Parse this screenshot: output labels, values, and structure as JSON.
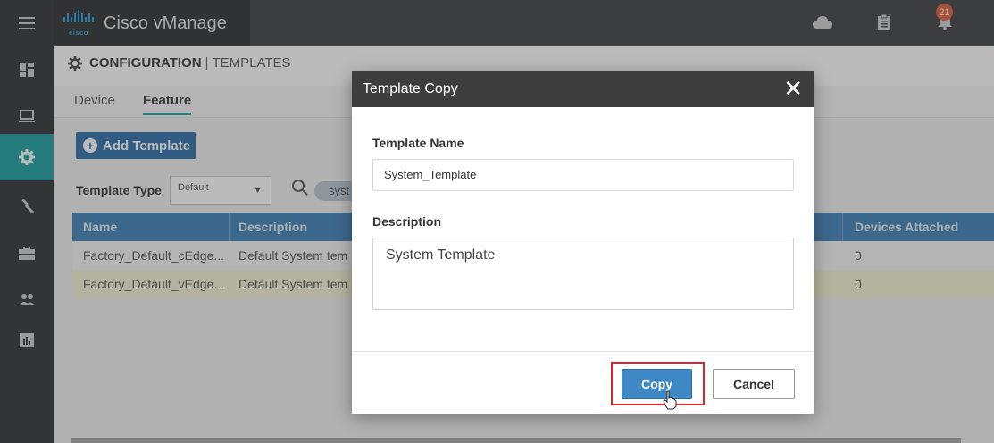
{
  "app": {
    "brand_text": "cisco",
    "title": "Cisco vManage"
  },
  "rail": {
    "items": [
      {
        "icon": "menu-icon"
      },
      {
        "icon": "dashboard-icon"
      },
      {
        "icon": "monitor-icon"
      },
      {
        "icon": "gear-icon",
        "active": true
      },
      {
        "icon": "wrench-icon"
      },
      {
        "icon": "briefcase-icon"
      },
      {
        "icon": "users-icon"
      },
      {
        "icon": "analytics-icon"
      }
    ]
  },
  "topbar": {
    "icons": [
      "cloud-icon",
      "clipboard-icon",
      "bell-icon"
    ],
    "notification_count": "21"
  },
  "breadcrumb": {
    "section": "CONFIGURATION",
    "separator": "|",
    "page": "TEMPLATES"
  },
  "tabs": [
    {
      "label": "Device"
    },
    {
      "label": "Feature",
      "active": true
    }
  ],
  "toolbar": {
    "add_template": "Add Template",
    "template_type_label": "Template Type",
    "template_type_value": "Default",
    "search_chip": "syst"
  },
  "table": {
    "headers": [
      "Name",
      "Description",
      "Devices Attached"
    ],
    "rows": [
      {
        "name": "Factory_Default_cEdge...",
        "description": "Default System tem",
        "devices": "0"
      },
      {
        "name": "Factory_Default_vEdge...",
        "description": "Default System tem",
        "devices": "0"
      }
    ]
  },
  "modal": {
    "title": "Template Copy",
    "name_label": "Template Name",
    "name_value": "System_Template",
    "description_label": "Description",
    "description_value": "System Template",
    "copy_label": "Copy",
    "cancel_label": "Cancel"
  },
  "colors": {
    "accent": "#1b9fa0",
    "header_blue": "#3d80b9",
    "primary_button": "#3e88c5",
    "highlight": "#d9262d"
  }
}
